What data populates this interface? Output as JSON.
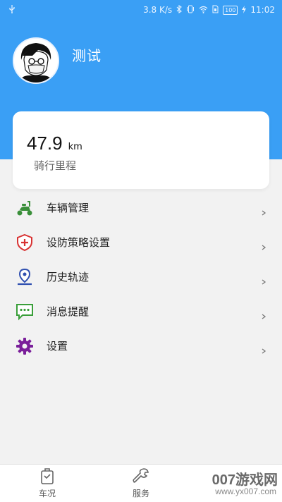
{
  "status_bar": {
    "speed": "3.8 K/s",
    "battery": "100",
    "time": "11:02"
  },
  "profile": {
    "username": "测试"
  },
  "stats": {
    "mileage_value": "47.9",
    "mileage_unit": "km",
    "mileage_label": "骑行里程"
  },
  "menu": {
    "items": [
      {
        "label": "车辆管理",
        "icon": "scooter-icon",
        "color": "#3a8f3a"
      },
      {
        "label": "设防策略设置",
        "icon": "shield-plus-icon",
        "color": "#d83232"
      },
      {
        "label": "历史轨迹",
        "icon": "location-pin-icon",
        "color": "#2f4fb0"
      },
      {
        "label": "消息提醒",
        "icon": "chat-bubble-icon",
        "color": "#3a9f3a"
      },
      {
        "label": "设置",
        "icon": "gear-icon",
        "color": "#7a1f9a"
      }
    ]
  },
  "tabbar": {
    "tabs": [
      {
        "label": "车况",
        "icon": "vehicle-status-icon"
      },
      {
        "label": "服务",
        "icon": "wrench-icon"
      }
    ]
  },
  "watermark": {
    "text": "007游戏网",
    "url": "www.yx007.com"
  },
  "colors": {
    "header": "#3a9ff5",
    "background": "#f2f2f2"
  }
}
